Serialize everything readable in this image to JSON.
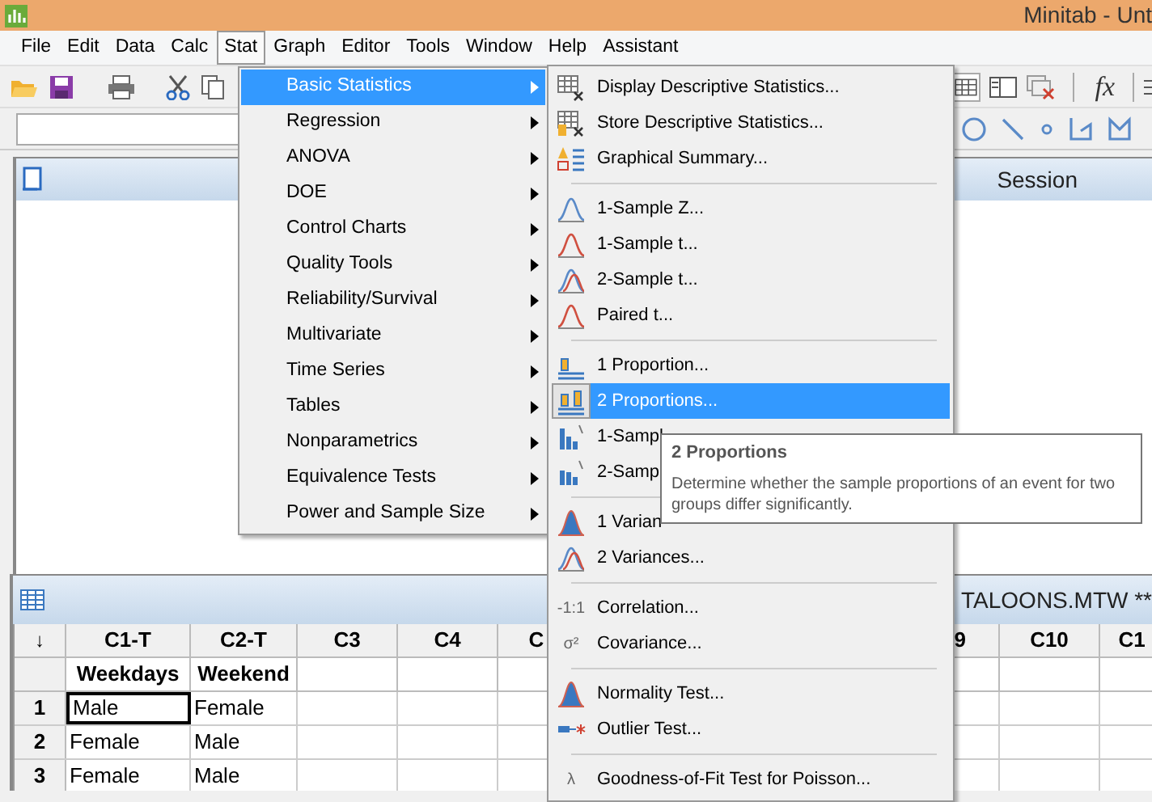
{
  "window": {
    "title": "Minitab - Unt"
  },
  "menu_bar": [
    {
      "label": "File",
      "selected": false
    },
    {
      "label": "Edit",
      "selected": false
    },
    {
      "label": "Data",
      "selected": false
    },
    {
      "label": "Calc",
      "selected": false
    },
    {
      "label": "Stat",
      "selected": true
    },
    {
      "label": "Graph",
      "selected": false
    },
    {
      "label": "Editor",
      "selected": false
    },
    {
      "label": "Tools",
      "selected": false
    },
    {
      "label": "Window",
      "selected": false
    },
    {
      "label": "Help",
      "selected": false
    },
    {
      "label": "Assistant",
      "selected": false
    }
  ],
  "toolbar": {
    "formula_button": "fx"
  },
  "session": {
    "title": "Session"
  },
  "worksheet": {
    "title": "TALOONS.MTW **",
    "corner": "↓",
    "columns": [
      {
        "label": "C1-T",
        "name": "Weekdays"
      },
      {
        "label": "C2-T",
        "name": "Weekend"
      },
      {
        "label": "C3"
      },
      {
        "label": "C4"
      },
      {
        "label": "C"
      },
      {
        "label": "9"
      },
      {
        "label": "C10"
      },
      {
        "label": "C1"
      }
    ],
    "rows": [
      {
        "label": "1",
        "cells": [
          {
            "text": "Male",
            "selected": true
          },
          {
            "text": "Female",
            "selected": false
          }
        ]
      },
      {
        "label": "2",
        "cells": [
          {
            "text": "Female",
            "selected": false
          },
          {
            "text": "Male",
            "selected": false
          }
        ]
      },
      {
        "label": "3",
        "cells": [
          {
            "text": "Female",
            "selected": false
          },
          {
            "text": "Male",
            "selected": false
          }
        ]
      }
    ]
  },
  "stat_menu": [
    {
      "label": "Basic Statistics",
      "selected": true
    },
    {
      "label": "Regression",
      "selected": false
    },
    {
      "label": "ANOVA",
      "selected": false
    },
    {
      "label": "DOE",
      "selected": false
    },
    {
      "label": "Control Charts",
      "selected": false
    },
    {
      "label": "Quality Tools",
      "selected": false
    },
    {
      "label": "Reliability/Survival",
      "selected": false
    },
    {
      "label": "Multivariate",
      "selected": false
    },
    {
      "label": "Time Series",
      "selected": false
    },
    {
      "label": "Tables",
      "selected": false
    },
    {
      "label": "Nonparametrics",
      "selected": false
    },
    {
      "label": "Equivalence Tests",
      "selected": false
    },
    {
      "label": "Power and Sample Size",
      "selected": false
    }
  ],
  "submenu": [
    {
      "kind": "item",
      "label": "Display Descriptive Statistics...",
      "selected": false
    },
    {
      "kind": "item",
      "label": "Store Descriptive Statistics...",
      "selected": false
    },
    {
      "kind": "item",
      "label": "Graphical Summary...",
      "selected": false
    },
    {
      "kind": "separator"
    },
    {
      "kind": "item",
      "label": "1-Sample Z...",
      "selected": false
    },
    {
      "kind": "item",
      "label": "1-Sample t...",
      "selected": false
    },
    {
      "kind": "item",
      "label": "2-Sample t...",
      "selected": false
    },
    {
      "kind": "item",
      "label": "Paired t...",
      "selected": false
    },
    {
      "kind": "separator"
    },
    {
      "kind": "item",
      "label": "1 Proportion...",
      "selected": false
    },
    {
      "kind": "item",
      "label": "2 Proportions...",
      "selected": true
    },
    {
      "kind": "item",
      "label": "1-Sampl",
      "selected": false
    },
    {
      "kind": "item",
      "label": "2-Samp",
      "selected": false
    },
    {
      "kind": "separator"
    },
    {
      "kind": "item",
      "label": "1 Varian",
      "selected": false
    },
    {
      "kind": "item",
      "label": "2 Variances...",
      "selected": false
    },
    {
      "kind": "separator"
    },
    {
      "kind": "item",
      "label": "Correlation...",
      "selected": false,
      "icon_text": "-1:1"
    },
    {
      "kind": "item",
      "label": "Covariance...",
      "selected": false,
      "icon_text": "σ²"
    },
    {
      "kind": "separator"
    },
    {
      "kind": "item",
      "label": "Normality Test...",
      "selected": false
    },
    {
      "kind": "item",
      "label": "Outlier Test...",
      "selected": false
    },
    {
      "kind": "separator"
    },
    {
      "kind": "item",
      "label": "Goodness-of-Fit Test for Poisson...",
      "selected": false,
      "icon_text": "λ"
    }
  ],
  "tooltip": {
    "title": "2 Proportions",
    "text": "Determine whether the sample proportions of an event for two groups differ significantly."
  }
}
